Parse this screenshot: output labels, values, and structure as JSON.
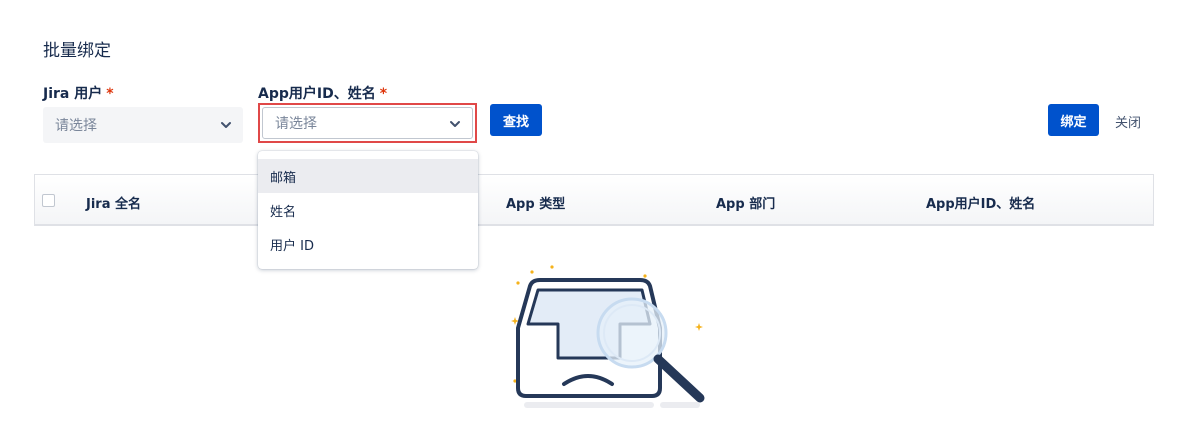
{
  "page": {
    "title": "批量绑定"
  },
  "form": {
    "jira_user": {
      "label": "Jira 用户",
      "required_mark": "*",
      "placeholder": "请选择"
    },
    "app_user": {
      "label": "App用户ID、姓名",
      "required_mark": "*",
      "placeholder": "请选择"
    },
    "search_label": "查找"
  },
  "actions": {
    "bind_label": "绑定",
    "close_label": "关闭"
  },
  "dropdown": {
    "options": [
      "邮箱",
      "姓名",
      "用户 ID"
    ],
    "highlighted_index": 0
  },
  "table": {
    "columns": [
      "Jira 全名",
      "App 类型",
      "App 部门",
      "App用户ID、姓名"
    ]
  },
  "colors": {
    "primary": "#0052cc",
    "required": "#de350b",
    "focus_outline": "#e04848",
    "sparkle": "#f5b21b"
  },
  "icons": {
    "select_chevron": "chevron-down-icon",
    "empty": "empty-box-magnifier-illustration"
  }
}
